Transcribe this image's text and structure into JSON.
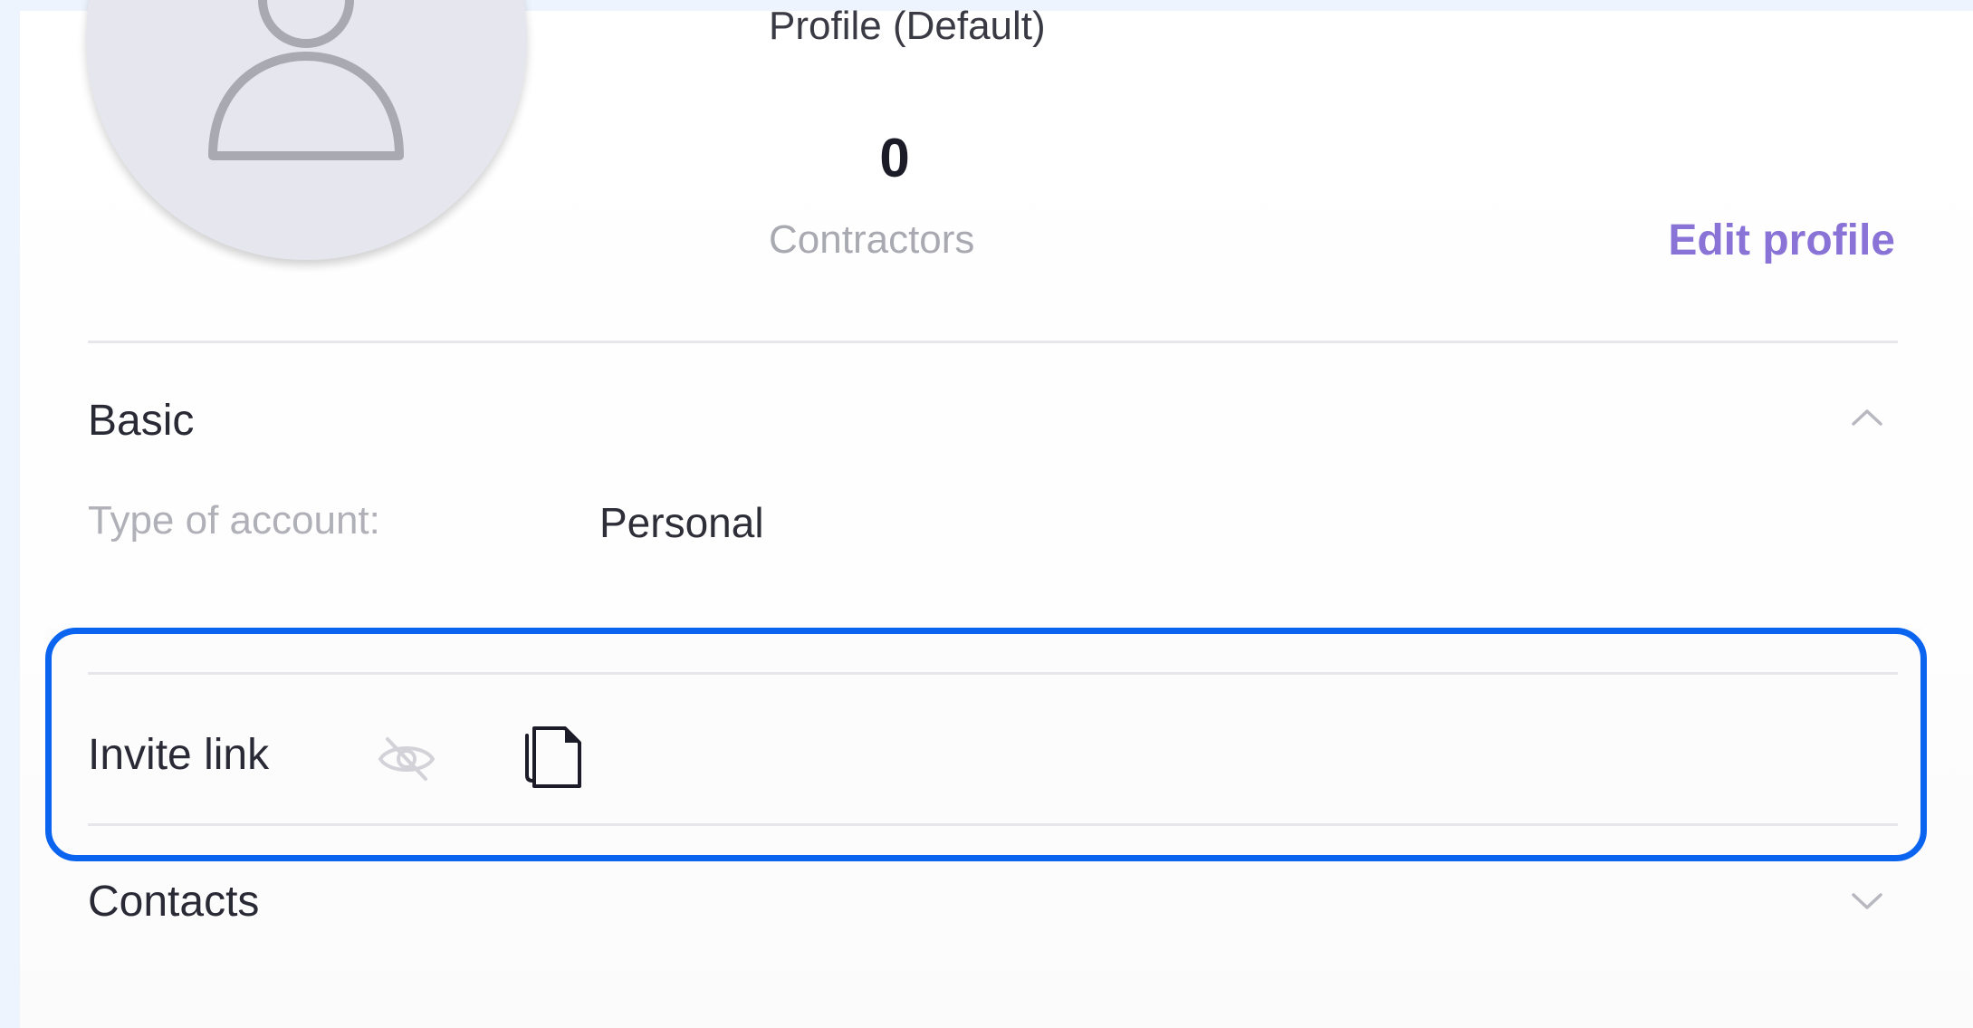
{
  "profile": {
    "name": "Profile (Default)",
    "avatar_icon": "user-placeholder-icon",
    "stats": [
      {
        "value": "0",
        "label": "Contractors"
      }
    ],
    "edit_label": "Edit profile"
  },
  "sections": {
    "basic": {
      "title": "Basic",
      "expanded": true,
      "fields": [
        {
          "label": "Type of account:",
          "value": "Personal"
        }
      ]
    },
    "invite": {
      "title": "Invite link",
      "icons": [
        "eye-off-icon",
        "copy-icon"
      ]
    },
    "contacts": {
      "title": "Contacts",
      "expanded": false
    }
  },
  "colors": {
    "accent": "#8a73d6",
    "highlight": "#0a64f0",
    "background": "#eef4fd"
  }
}
